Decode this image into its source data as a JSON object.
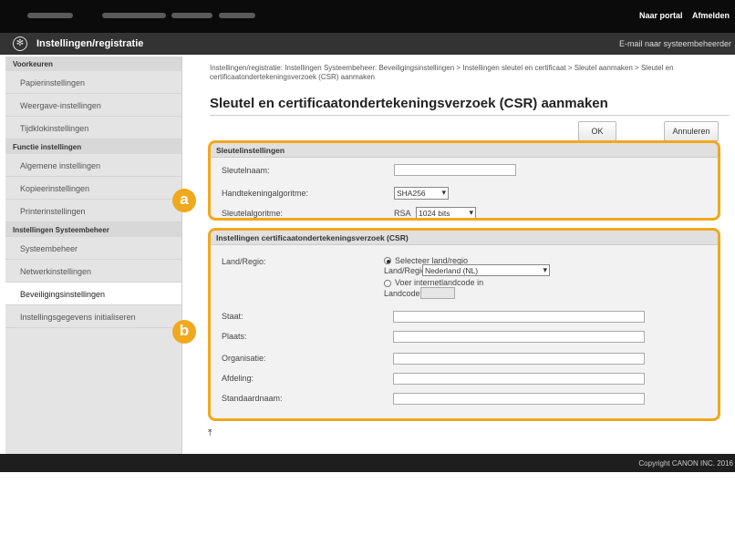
{
  "topbar": {
    "links": [
      "Naar portal",
      "Afmelden"
    ]
  },
  "titlebar": {
    "title": "Instellingen/registratie",
    "email_link": "E-mail naar systeembeheerder"
  },
  "sidebar": {
    "sections": [
      {
        "header": "Voorkeuren",
        "items": [
          "Papierinstellingen",
          "Weergave-instellingen",
          "Tijdklokinstellingen"
        ]
      },
      {
        "header": "Functie instellingen",
        "items": [
          "Algemene instellingen",
          "Kopieerinstellingen",
          "Printerinstellingen"
        ]
      },
      {
        "header": "Instellingen Systeembeheer",
        "items": [
          "Systeembeheer",
          "Netwerkinstellingen",
          "Beveiligingsinstellingen",
          "Instellingsgegevens initialiseren"
        ]
      }
    ],
    "active_item": "Beveiligingsinstellingen"
  },
  "main": {
    "breadcrumb": "Instellingen/registratie: Instellingen Systeembeheer: Beveiligingsinstellingen > Instellingen sleutel en certificaat > Sleutel aanmaken > Sleutel en certificaatondertekeningsverzoek (CSR) aanmaken",
    "heading": "Sleutel en certificaatondertekeningsverzoek (CSR) aanmaken",
    "ok_label": "OK",
    "cancel_label": "Annuleren"
  },
  "key_panel": {
    "badge": "a",
    "title": "Sleutelinstellingen",
    "key_name_label": "Sleutelnaam:",
    "key_name_value": "",
    "signature_label": "Handtekeningalgoritme:",
    "signature_value": "SHA256",
    "key_algorithm_label": "Sleutelalgoritme:",
    "key_algorithm_type": "RSA",
    "key_algorithm_value": "1024 bits"
  },
  "csr_panel": {
    "badge": "b",
    "title": "Instellingen certificaatondertekeningsverzoek (CSR)",
    "country_label": "Land/Regio:",
    "radio_select_label": "Selecteer land/regio",
    "country_select_label": "Land/Regio:",
    "country_value": "Nederland (NL)",
    "radio_internet_label": "Voer internetlandcode in",
    "country_code_label": "Landcode:",
    "state_label": "Staat:",
    "city_label": "Plaats:",
    "org_label": "Organisatie:",
    "dept_label": "Afdeling:",
    "common_name_label": "Standaardnaam:"
  },
  "footer": {
    "copyright": "Copyright CANON INC. 2016"
  },
  "colors": {
    "highlight": "#f0a81d",
    "topbar": "#0b0b0b",
    "titlebar": "#333333"
  }
}
